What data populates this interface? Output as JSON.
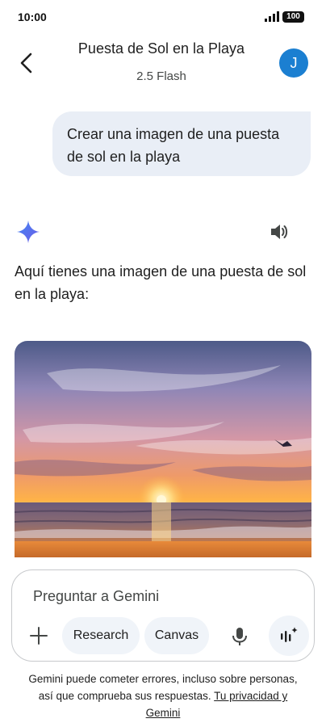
{
  "status_bar": {
    "time": "10:00",
    "battery": "100"
  },
  "header": {
    "title": "Puesta de Sol en la Playa",
    "model": "2.5 Flash",
    "avatar_initial": "J"
  },
  "conversation": {
    "user_prompt": "Crear una imagen de una puesta de sol en la playa",
    "response_text": "Aquí tienes una imagen de una puesta de sol en la playa:"
  },
  "input": {
    "placeholder": "Preguntar a Gemini",
    "chips": {
      "research": "Research",
      "canvas": "Canvas"
    }
  },
  "disclaimer": {
    "text": "Gemini puede cometer errores, incluso sobre personas, así que comprueba sus respuestas.",
    "link": "Tu privacidad y Gemini"
  },
  "icons": {
    "back": "arrow-left-icon",
    "sparkle": "gemini-sparkle-icon",
    "speaker": "speaker-icon",
    "plus": "plus-icon",
    "mic": "microphone-icon",
    "live": "live-waveform-icon"
  },
  "colors": {
    "accent": "#1b7fd1",
    "bubble": "#e9eef6",
    "chip": "#f0f4f9",
    "sparkle": "#4285f4"
  }
}
